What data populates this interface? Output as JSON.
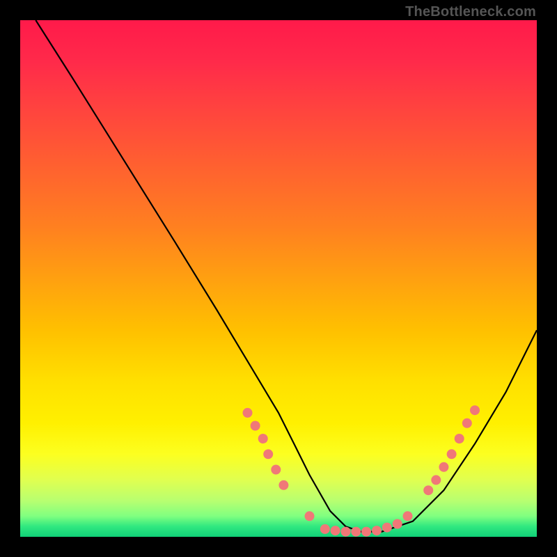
{
  "attribution": "TheBottleneck.com",
  "chart_data": {
    "type": "line",
    "title": "",
    "xlabel": "",
    "ylabel": "",
    "xlim": [
      0,
      100
    ],
    "ylim": [
      0,
      100
    ],
    "series": [
      {
        "name": "bottleneck-curve",
        "x": [
          3,
          10,
          20,
          30,
          38,
          44,
          50,
          53,
          56,
          60,
          63,
          66,
          70,
          76,
          82,
          88,
          94,
          100
        ],
        "y": [
          100,
          89,
          73,
          57,
          44,
          34,
          24,
          18,
          12,
          5,
          2,
          1,
          1,
          3,
          9,
          18,
          28,
          40
        ]
      }
    ],
    "markers": [
      {
        "x": 44.0,
        "y": 24.0
      },
      {
        "x": 45.5,
        "y": 21.5
      },
      {
        "x": 47.0,
        "y": 19.0
      },
      {
        "x": 48.0,
        "y": 16.0
      },
      {
        "x": 49.5,
        "y": 13.0
      },
      {
        "x": 51.0,
        "y": 10.0
      },
      {
        "x": 56.0,
        "y": 4.0
      },
      {
        "x": 59.0,
        "y": 1.5
      },
      {
        "x": 61.0,
        "y": 1.2
      },
      {
        "x": 63.0,
        "y": 1.0
      },
      {
        "x": 65.0,
        "y": 1.0
      },
      {
        "x": 67.0,
        "y": 1.0
      },
      {
        "x": 69.0,
        "y": 1.2
      },
      {
        "x": 71.0,
        "y": 1.8
      },
      {
        "x": 73.0,
        "y": 2.5
      },
      {
        "x": 75.0,
        "y": 4.0
      },
      {
        "x": 79.0,
        "y": 9.0
      },
      {
        "x": 80.5,
        "y": 11.0
      },
      {
        "x": 82.0,
        "y": 13.5
      },
      {
        "x": 83.5,
        "y": 16.0
      },
      {
        "x": 85.0,
        "y": 19.0
      },
      {
        "x": 86.5,
        "y": 22.0
      },
      {
        "x": 88.0,
        "y": 24.5
      }
    ],
    "marker_color": "#f07878",
    "curve_color": "#000000"
  }
}
